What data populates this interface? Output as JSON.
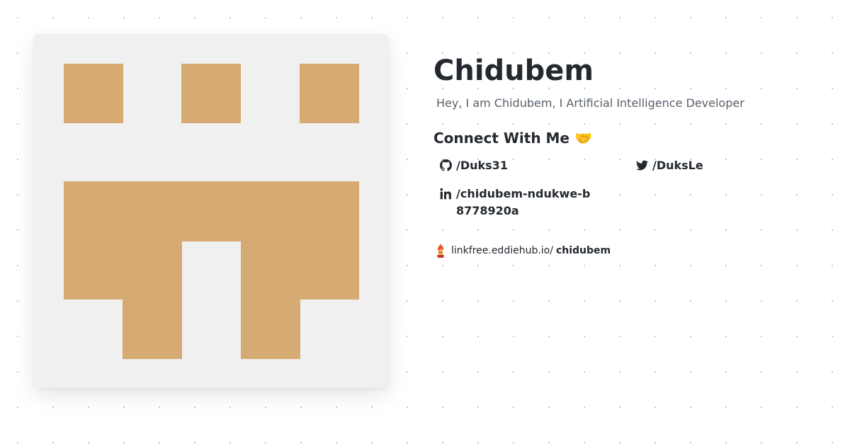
{
  "profile": {
    "name": "Chidubem",
    "bio": "Hey, I am Chidubem, I Artificial Intelligence Developer",
    "avatar_color": "#d6aa73",
    "avatar_bg": "#f0f0f0"
  },
  "connect": {
    "title": "Connect With Me",
    "emoji": "🤝"
  },
  "socials": [
    {
      "icon": "github-icon",
      "label": "/Duks31"
    },
    {
      "icon": "twitter-icon",
      "label": "/DuksLe"
    },
    {
      "icon": "linkedin-icon",
      "label": "/chidubem-ndukwe-b8778920a"
    }
  ],
  "footer": {
    "domain": "linkfree.eddiehub.io/",
    "username": "chidubem"
  }
}
